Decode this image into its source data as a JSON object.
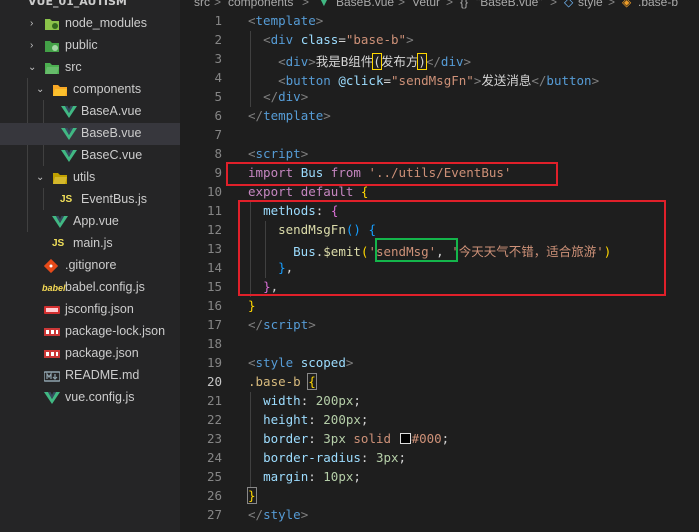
{
  "sidebar": {
    "project": "VUE_01_AUTISM",
    "items": [
      {
        "label": "node_modules",
        "type": "folder",
        "icon": "node-modules-folder-icon",
        "expanded": false
      },
      {
        "label": "public",
        "type": "folder",
        "icon": "public-folder-icon",
        "expanded": false
      },
      {
        "label": "src",
        "type": "folder",
        "icon": "src-folder-icon",
        "expanded": true
      },
      {
        "label": "components",
        "type": "folder",
        "icon": "components-folder-icon",
        "expanded": true
      },
      {
        "label": "BaseA.vue",
        "type": "file",
        "icon": "vue-icon"
      },
      {
        "label": "BaseB.vue",
        "type": "file",
        "icon": "vue-icon",
        "selected": true
      },
      {
        "label": "BaseC.vue",
        "type": "file",
        "icon": "vue-icon"
      },
      {
        "label": "utils",
        "type": "folder",
        "icon": "utils-folder-icon",
        "expanded": true
      },
      {
        "label": "EventBus.js",
        "type": "file",
        "icon": "js-icon"
      },
      {
        "label": "App.vue",
        "type": "file",
        "icon": "vue-icon"
      },
      {
        "label": "main.js",
        "type": "file",
        "icon": "js-icon"
      },
      {
        "label": ".gitignore",
        "type": "file",
        "icon": "git-icon"
      },
      {
        "label": "babel.config.js",
        "type": "file",
        "icon": "babel-icon"
      },
      {
        "label": "jsconfig.json",
        "type": "file",
        "icon": "json-icon"
      },
      {
        "label": "package-lock.json",
        "type": "file",
        "icon": "npm-icon"
      },
      {
        "label": "package.json",
        "type": "file",
        "icon": "npm-icon"
      },
      {
        "label": "README.md",
        "type": "file",
        "icon": "markdown-icon"
      },
      {
        "label": "vue.config.js",
        "type": "file",
        "icon": "vue-icon"
      }
    ]
  },
  "breadcrumb": {
    "parts": [
      "src",
      "components",
      "BaseB.vue",
      "Vetur",
      "\"BaseB.vue\"",
      "style",
      ".base-b"
    ],
    "separators": [
      ">",
      ">",
      ">",
      ">",
      ">",
      ">"
    ]
  },
  "editor": {
    "active_line": 20,
    "lines": [
      {
        "n": "1"
      },
      {
        "n": "2"
      },
      {
        "n": "3"
      },
      {
        "n": "4"
      },
      {
        "n": "5"
      },
      {
        "n": "6"
      },
      {
        "n": "7"
      },
      {
        "n": "8"
      },
      {
        "n": "9"
      },
      {
        "n": "10"
      },
      {
        "n": "11"
      },
      {
        "n": "12"
      },
      {
        "n": "13"
      },
      {
        "n": "14"
      },
      {
        "n": "15"
      },
      {
        "n": "16"
      },
      {
        "n": "17"
      },
      {
        "n": "18"
      },
      {
        "n": "19"
      },
      {
        "n": "20"
      },
      {
        "n": "21"
      },
      {
        "n": "22"
      },
      {
        "n": "23"
      },
      {
        "n": "24"
      },
      {
        "n": "25"
      },
      {
        "n": "26"
      },
      {
        "n": "27"
      }
    ],
    "code": {
      "l1_template_open": "template",
      "l2_div": "div",
      "l2_class_attr": "class",
      "l2_class_val": "\"base-b\"",
      "l3_text": "我是B组件",
      "l3_paren_open": "(",
      "l3_text2": "发布方",
      "l3_paren_close": ")",
      "l4_button": "button",
      "l4_click_attr": "@click",
      "l4_click_val": "\"sendMsgFn\"",
      "l4_text": "发送消息",
      "l7_template_close": "template",
      "l8_script": "script",
      "l9_import": "import",
      "l9_bus": "Bus",
      "l9_from": "from",
      "l9_path": "'../utils/EventBus'",
      "l10_export": "export",
      "l10_default": "default",
      "l11_methods": "methods",
      "l12_fn": "sendMsgFn",
      "l13_bus": "Bus",
      "l13_emit": "$emit",
      "l13_arg1": "'sendMsg'",
      "l13_arg2": "'今天天气不错，适合旅游'",
      "l17_script_close": "script",
      "l19_style": "style",
      "l19_scoped": "scoped",
      "l20_selector": ".base-b",
      "l21_prop": "width",
      "l21_val": "200px",
      "l22_prop": "height",
      "l22_val": "200px",
      "l23_prop": "border",
      "l23_val1": "3px",
      "l23_val2": "solid",
      "l23_val3": "#000",
      "l24_prop": "border-radius",
      "l24_val": "3px",
      "l25_prop": "margin",
      "l25_val": "10px",
      "l27_style_close": "style"
    }
  },
  "colors": {
    "background": "#1e1e1e",
    "sidebar": "#252526",
    "annotation_red": "#e0202a",
    "annotation_green": "#14b54b"
  }
}
